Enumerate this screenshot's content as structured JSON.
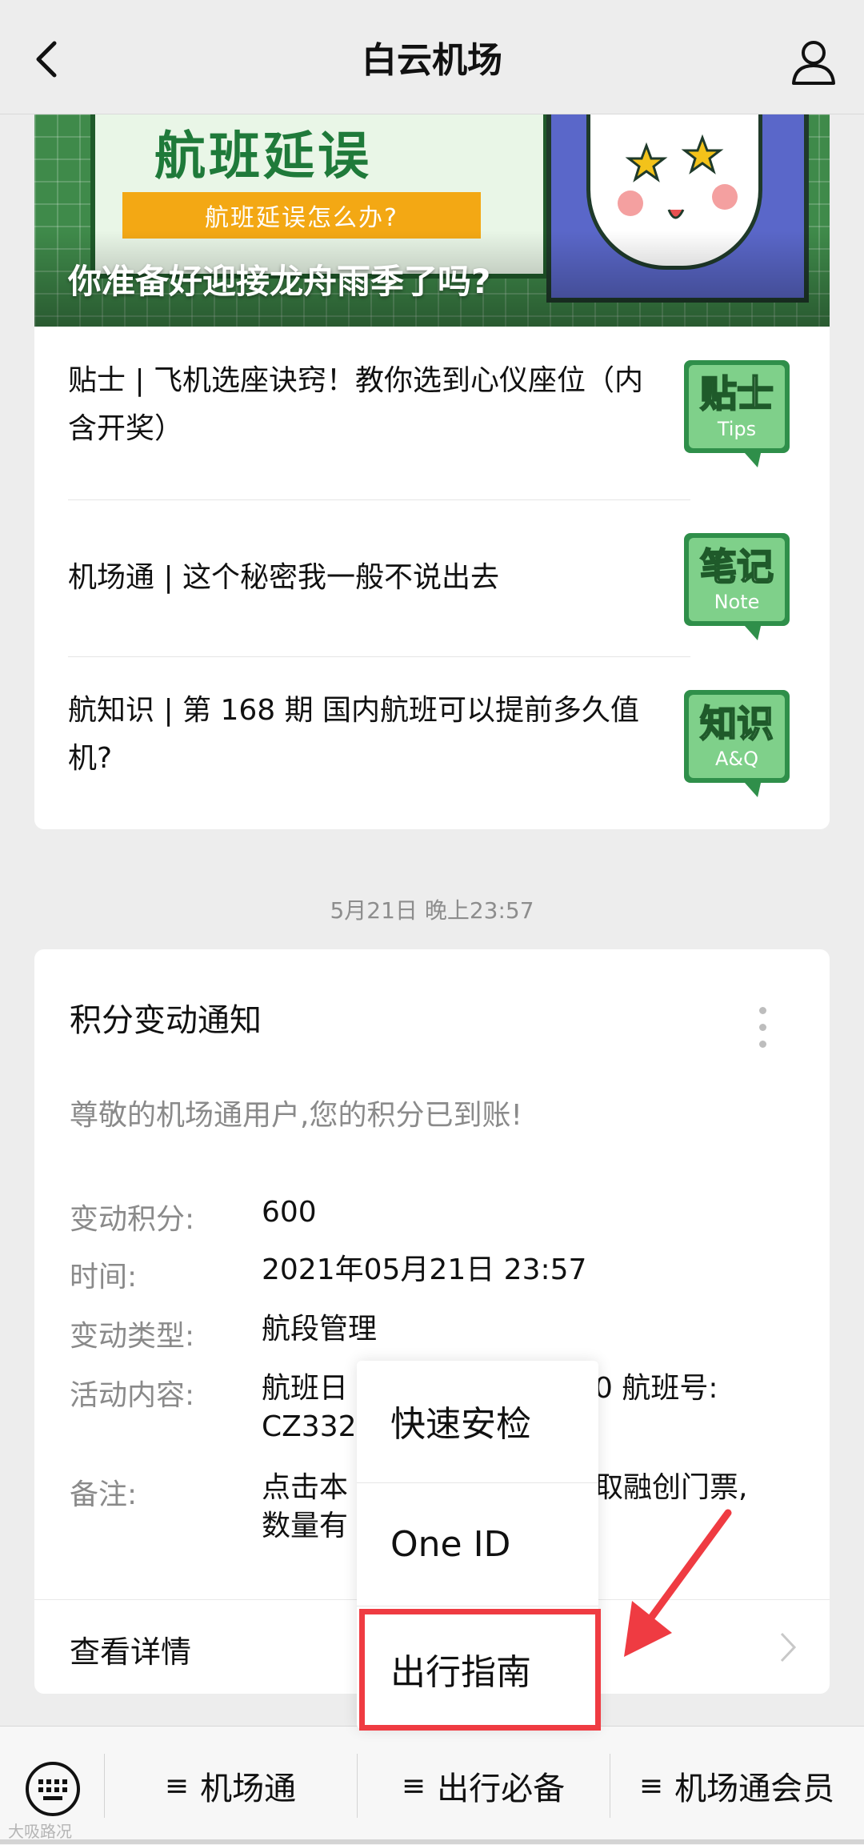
{
  "header": {
    "title": "白云机场"
  },
  "banner": {
    "headline": "航班延误",
    "subheadline": "航班延误怎么办?",
    "caption": "你准备好迎接龙舟雨季了吗?"
  },
  "articles": [
    {
      "title": "贴士 | 飞机选座诀窍！教你选到心仪座位（内含开奖）",
      "badge_main": "贴士",
      "badge_sub": "Tips"
    },
    {
      "title": "机场通 | 这个秘密我一般不说出去",
      "badge_main": "笔记",
      "badge_sub": "Note"
    },
    {
      "title": "航知识 | 第 168 期 国内航班可以提前多久值机?",
      "badge_main": "知识",
      "badge_sub": "A&Q"
    }
  ],
  "timestamp": "5月21日 晚上23:57",
  "notice": {
    "title": "积分变动通知",
    "greeting": "尊敬的机场通用户,您的积分已到账!",
    "fields": [
      {
        "label": "变动积分:",
        "value": "600"
      },
      {
        "label": "时间:",
        "value": "2021年05月21日 23:57"
      },
      {
        "label": "变动类型:",
        "value": "航段管理"
      },
      {
        "label": "活动内容:",
        "value_left": "航班日",
        "value_right": "0  航班号:",
        "value_line2": "CZ332"
      },
      {
        "label": "备注:",
        "value_left": "点击本",
        "value_right": "取融创门票,",
        "value_line2": "数量有"
      }
    ],
    "detail_label": "查看详情"
  },
  "popup_menu": {
    "items": [
      "快速安检",
      "One ID",
      "出行指南"
    ],
    "highlighted_index": 2,
    "highlight_color": "#ef3b42"
  },
  "bottom_menu": {
    "items": [
      "机场通",
      "出行必备",
      "机场通会员"
    ]
  },
  "watermark": "大吸路况",
  "colors": {
    "brand_green": "#1f7a3a",
    "accent_yellow": "#f3a814",
    "annotation_red": "#ef3b42"
  }
}
